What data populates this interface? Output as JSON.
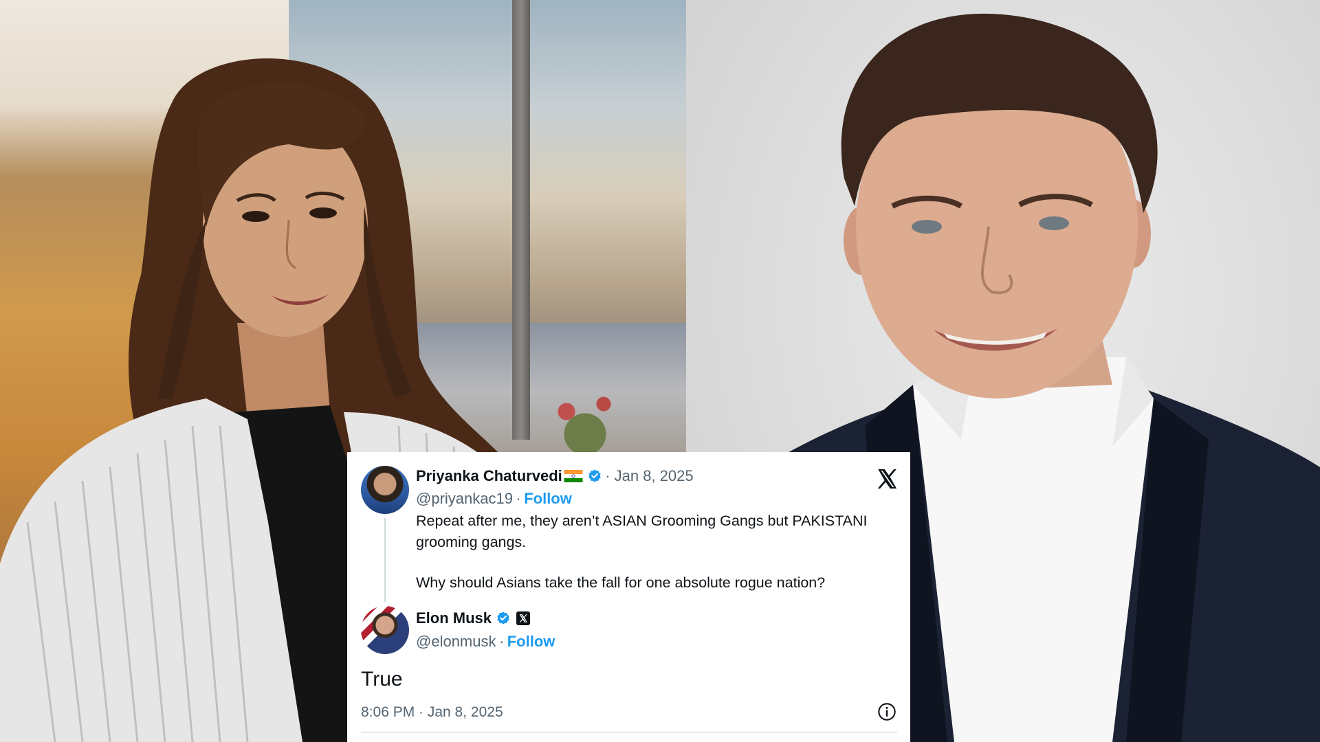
{
  "tweet": {
    "author_name": "Priyanka Chaturvedi",
    "author_handle": "@priyankac19",
    "date_sep": "· Jan 8, 2025",
    "separator": "·",
    "follow_label": "Follow",
    "text_line1": "Repeat after me, they aren’t ASIAN Grooming Gangs but PAKISTANI",
    "text_line2": "grooming gangs.",
    "text_line3": "Why should Asians take the fall for one absolute rogue nation?"
  },
  "reply": {
    "author_name": "Elon Musk",
    "author_handle": "@elonmusk",
    "separator": "·",
    "follow_label": "Follow",
    "text": "True",
    "timestamp": "8:06 PM · Jan 8, 2025"
  },
  "icons": {
    "platform_logo": "x-logo-icon",
    "verified": "verified-badge-icon",
    "info": "info-icon",
    "country_flag": "india-flag-icon",
    "affiliation": "x-affiliation-icon"
  },
  "colors": {
    "link_blue": "#1d9bf0",
    "verified_blue": "#1d9bf0",
    "text_primary": "#0f1419",
    "text_secondary": "#536471"
  }
}
